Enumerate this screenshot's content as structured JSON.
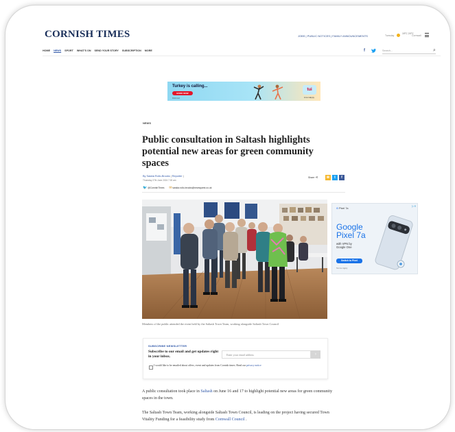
{
  "header": {
    "brand": "CORNISH TIMES",
    "top_links": "JOBS | PUBLIC NOTICES | FAMILY ANNOUNCEMENTS",
    "weather_left": "Tuesday",
    "weather_mid": "19°C 24°C",
    "weather_right": "Cornwall"
  },
  "nav": {
    "items": [
      "HOME",
      "NEWS",
      "SPORT",
      "WHAT'S ON",
      "SEND YOUR STORY",
      "SUBSCRIPTION",
      "MORE"
    ],
    "active_index": 1,
    "search_placeholder": "Search..."
  },
  "top_ad": {
    "title": "Turkey is calling...",
    "button": "BOOK NOW",
    "small": "Find out",
    "logo": "tui",
    "logo_sub": "Live Happy"
  },
  "article": {
    "section": "NEWS",
    "headline": "Public consultation in Saltash highlights potential new areas for green community spaces",
    "author": "By Saskia Rollo-Brooks",
    "role": "Reporter",
    "date": "Thursday 27th June 2024 7:00 am",
    "twitter": "@CornishTimes",
    "email": "saskia.rollo-brooks@newsquest.co.uk",
    "share_label": "Share",
    "caption": "Members of the public attended the event held by the Saltash Town Team, working alongside Saltash Town Council",
    "para1_pre": "A public consultation took place in",
    "para1_link": "Saltash",
    "para1_post": " on June 16 and 17 to highlight potential new areas for green community spaces in the town.",
    "para2_pre": "The Saltash Town Team, working alongside Saltash Town Council, is leading on the project having secured Town Vitality Funding for a feasibility study from",
    "para2_link": "Cornwall Council",
    "para2_post": " ."
  },
  "newsletter": {
    "label": "SUBSCRIBE NEWSLETTER",
    "heading": "Subscribe to our email and get updates right in your inbox.",
    "placeholder": "Enter your email address",
    "consent": "I would like to be emailed about offers, event and updates from Cornish times. Read our",
    "consent_link": "privacy notice"
  },
  "side_ad": {
    "label": "Pixel 7a",
    "title": "Google Pixel 7a",
    "subtitle": "with VPN by Google One",
    "button": "Switch to Pixel",
    "link": "Terms Apply"
  },
  "colors": {
    "brand": "#1a2f5a",
    "link": "#2f57a8",
    "twitter": "#1da1f2",
    "facebook": "#3b5998"
  }
}
